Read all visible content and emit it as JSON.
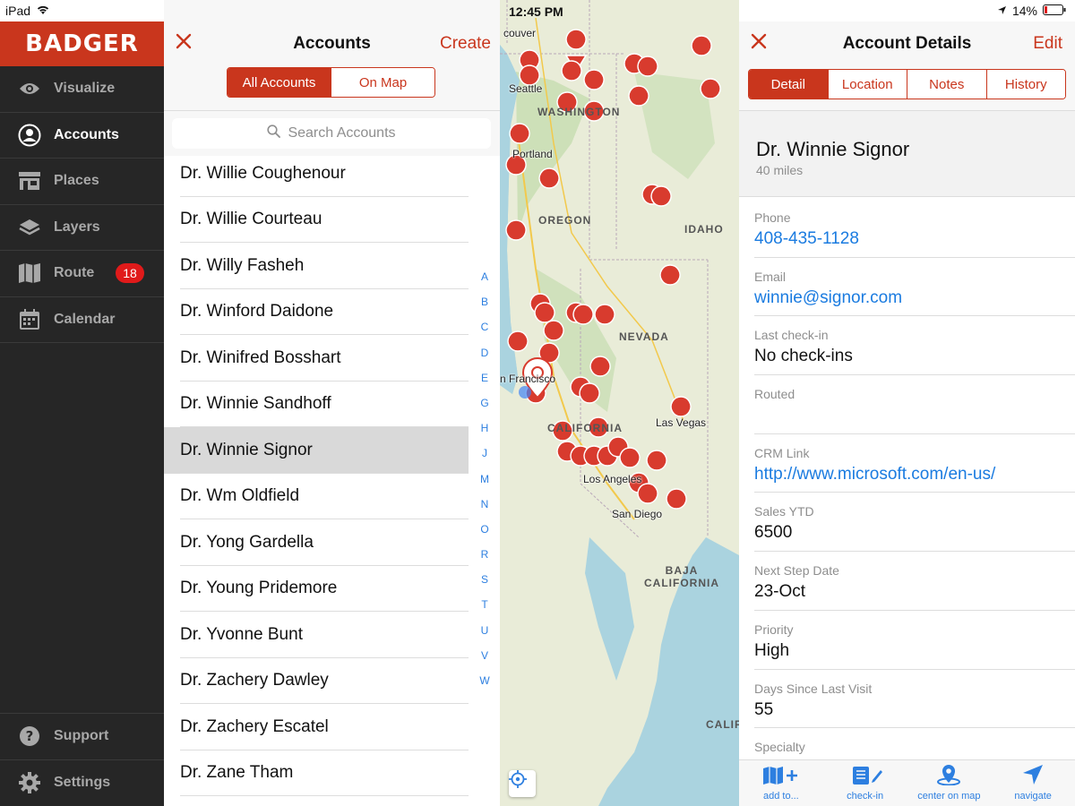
{
  "status": {
    "device": "iPad",
    "time": "12:45 PM",
    "battery": "14%"
  },
  "brand": {
    "name": "BADGER",
    "color": "#c9361d"
  },
  "sidebar": {
    "items": [
      {
        "label": "Visualize",
        "icon": "eye-icon"
      },
      {
        "label": "Accounts",
        "icon": "person-circle-icon"
      },
      {
        "label": "Places",
        "icon": "store-icon"
      },
      {
        "label": "Layers",
        "icon": "layers-icon"
      },
      {
        "label": "Route",
        "icon": "map-icon",
        "badge": "18"
      },
      {
        "label": "Calendar",
        "icon": "calendar-icon"
      }
    ],
    "bottom": [
      {
        "label": "Support",
        "icon": "help-icon"
      },
      {
        "label": "Settings",
        "icon": "gear-icon"
      }
    ]
  },
  "accounts": {
    "title": "Accounts",
    "create_label": "Create",
    "segments": [
      "All Accounts",
      "On Map"
    ],
    "search_placeholder": "Search Accounts",
    "rows": [
      "Dr. Willie Coughenour",
      "Dr. Willie Courteau",
      "Dr. Willy Fasheh",
      "Dr. Winford Daidone",
      "Dr. Winifred Bosshart",
      "Dr. Winnie Sandhoff",
      "Dr. Winnie Signor",
      "Dr. Wm Oldfield",
      "Dr. Yong Gardella",
      "Dr. Young Pridemore",
      "Dr. Yvonne Bunt",
      "Dr. Zachery Dawley",
      "Dr. Zachery Escatel",
      "Dr. Zane Tham"
    ],
    "selected": "Dr. Winnie Signor",
    "index": [
      "A",
      "B",
      "C",
      "D",
      "E",
      "G",
      "H",
      "J",
      "M",
      "N",
      "O",
      "R",
      "S",
      "T",
      "U",
      "V",
      "W"
    ]
  },
  "map": {
    "regions": [
      "WASHINGTON",
      "OREGON",
      "IDAHO",
      "NEVADA",
      "CALIFORNIA",
      "BAJA CALIFORNIA",
      "CALIF"
    ],
    "cities": [
      "Seattle",
      "Portland",
      "Las Vegas",
      "Los Angeles",
      "San Diego",
      "n Francisco",
      "couver"
    ]
  },
  "detail": {
    "title": "Account Details",
    "edit_label": "Edit",
    "tabs": [
      "Detail",
      "Location",
      "Notes",
      "History"
    ],
    "name": "Dr. Winnie Signor",
    "distance": "40 miles",
    "fields": [
      {
        "label": "Phone",
        "value": "408-435-1128",
        "link": true
      },
      {
        "label": "Email",
        "value": "winnie@signor.com",
        "link": true
      },
      {
        "label": "Last check-in",
        "value": "No check-ins"
      },
      {
        "label": "Routed",
        "value": ""
      },
      {
        "label": "CRM Link",
        "value": "http://www.microsoft.com/en-us/",
        "link": true
      },
      {
        "label": "Sales YTD",
        "value": "6500"
      },
      {
        "label": "Next Step Date",
        "value": "23-Oct"
      },
      {
        "label": "Priority",
        "value": "High"
      },
      {
        "label": "Days Since Last Visit",
        "value": "55"
      },
      {
        "label": "Specialty",
        "value": ""
      }
    ],
    "toolbar": [
      "add to...",
      "check-in",
      "center on map",
      "navigate"
    ]
  }
}
